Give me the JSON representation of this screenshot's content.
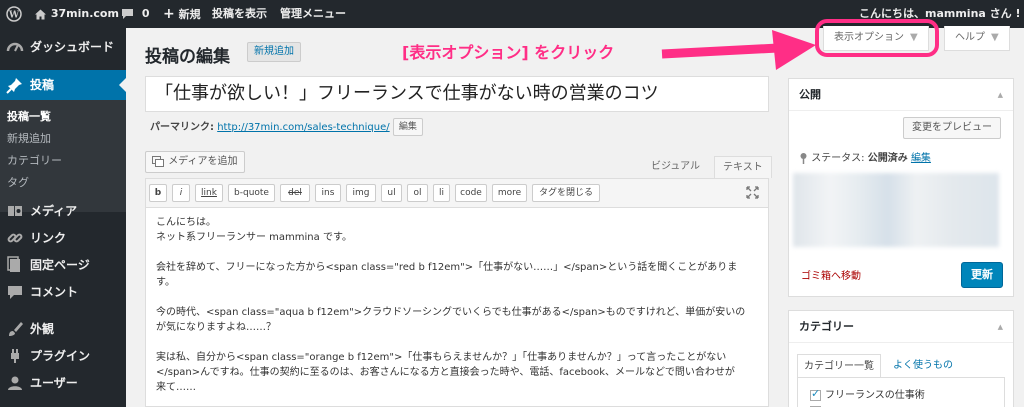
{
  "adminbar": {
    "site_name": "37min.com",
    "comments_count": "0",
    "new_label": "新規",
    "view_post": "投稿を表示",
    "admin_menu": "管理メニュー",
    "greeting": "こんにちは、mammina さん !"
  },
  "sidebar": {
    "items": [
      {
        "label": "ダッシュボード",
        "icon": "dashboard-icon"
      },
      {
        "label": "投稿",
        "icon": "pin-icon"
      },
      {
        "label": "メディア",
        "icon": "media-icon"
      },
      {
        "label": "リンク",
        "icon": "link-icon"
      },
      {
        "label": "固定ページ",
        "icon": "page-icon"
      },
      {
        "label": "コメント",
        "icon": "comment-icon"
      },
      {
        "label": "外観",
        "icon": "brush-icon"
      },
      {
        "label": "プラグイン",
        "icon": "plugin-icon"
      },
      {
        "label": "ユーザー",
        "icon": "user-icon"
      }
    ],
    "submenu": [
      "投稿一覧",
      "新規追加",
      "カテゴリー",
      "タグ"
    ]
  },
  "main": {
    "title": "投稿の編集",
    "add_new": "新規追加",
    "annotation": "[表示オプション] をクリック",
    "screen_options": "表示オプション",
    "help": "ヘルプ",
    "post_title": "「仕事が欲しい！」フリーランスで仕事がない時の営業のコツ",
    "permalink_label": "パーマリンク:",
    "permalink_url": "http://37min.com/sales-technique/",
    "permalink_edit": "編集",
    "add_media": "メディアを追加",
    "tab_visual": "ビジュアル",
    "tab_text": "テキスト",
    "quicktags": [
      "b",
      "i",
      "link",
      "b-quote",
      "del",
      "ins",
      "img",
      "ul",
      "ol",
      "li",
      "code",
      "more",
      "タグを閉じる"
    ],
    "content_lines": [
      "こんにちは。",
      "ネット系フリーランサー mammina です。",
      "",
      "会社を辞めて、フリーになった方から<span class=\"red b f12em\">「仕事がない……」</span>という話を聞くことがありま",
      "す。",
      "",
      "今の時代、<span class=\"aqua b f12em\">クラウドソーシングでいくらでも仕事がある</span>ものですけれど、単価が安いの",
      "が気になりますよね……？",
      "",
      "実は私、自分から<span class=\"orange b f12em\">「仕事もらえませんか？」「仕事ありませんか？」って言ったことがない",
      "</span>んですね。仕事の契約に至るのは、お客さんになる方と直接会った時や、電話、facebook、メールなどで問い合わせが",
      "来て……"
    ]
  },
  "publish": {
    "title": "公開",
    "preview": "変更をプレビュー",
    "status_label": "ステータス:",
    "status_value": "公開済み",
    "status_edit": "編集",
    "trash": "ゴミ箱へ移動",
    "update": "更新"
  },
  "categories": {
    "title": "カテゴリー",
    "tab_all": "カテゴリー一覧",
    "tab_popular": "よく使うもの",
    "items": [
      {
        "label": "フリーランスの仕事術",
        "checked": true
      },
      {
        "label": "",
        "checked": false
      }
    ]
  },
  "colors": {
    "accent": "#0073aa",
    "annotation": "#ff2e86",
    "admin_bg": "#23282d"
  }
}
